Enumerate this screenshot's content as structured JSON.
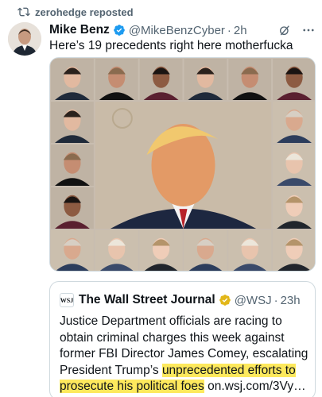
{
  "repost": {
    "text": "zerohedge reposted",
    "icon": "repost-icon"
  },
  "tweet": {
    "author_name": "Mike Benz",
    "handle": "@MikeBenzCyber",
    "dot": "·",
    "time": "2h",
    "text": "Here’s 19 precedents right here motherfucka",
    "verified_color": "#1d9bf0",
    "media_description_icon": "mugshot-collage-image"
  },
  "quote": {
    "logo": "WSJ",
    "source_name": "The Wall Street Journal",
    "handle": "@WSJ",
    "dot": "·",
    "time": "23h",
    "badge_color": "#e2b719",
    "text_plain": "Justice Department officials are racing to obtain criminal charges this week against former FBI Director James Comey, escalating President Trump’s ",
    "text_highlight": "unprecedented efforts to prosecute his political foes",
    "text_link": " on.wsj.com/3Vy…",
    "highlight_color": "#fde95d"
  }
}
